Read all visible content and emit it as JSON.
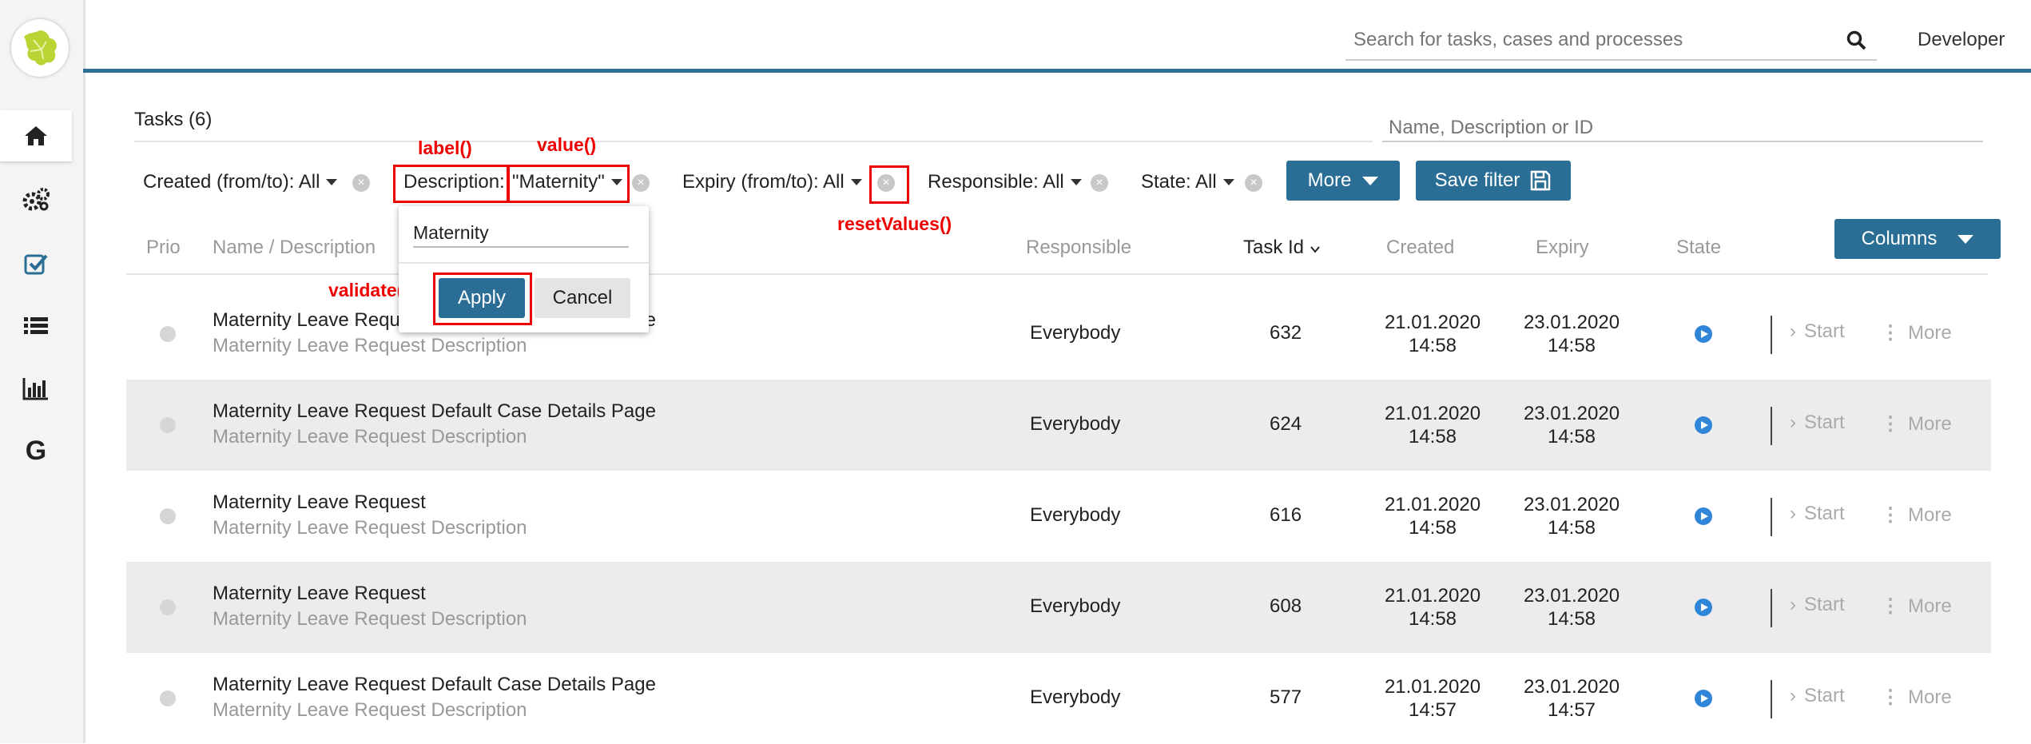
{
  "sidebar": {
    "items": [
      {
        "icon": "home-icon"
      },
      {
        "icon": "gears-icon"
      },
      {
        "icon": "checkbox-icon"
      },
      {
        "icon": "list-icon"
      },
      {
        "icon": "chart-icon"
      },
      {
        "icon": "g-icon",
        "label": "G"
      }
    ]
  },
  "header": {
    "search_placeholder": "Search for tasks, cases and processes",
    "user": "Developer"
  },
  "tasks": {
    "title": "Tasks (6)",
    "quick_search_placeholder": "Name, Description or ID"
  },
  "filters": {
    "created": "Created (from/to): All",
    "description_label": "Description:",
    "description_value": "\"Maternity\"",
    "expiry": "Expiry (from/to): All",
    "responsible": "Responsible: All",
    "state": "State: All",
    "more_button": "More",
    "save_filter_button": "Save filter"
  },
  "popup": {
    "input_value": "Maternity",
    "apply_label": "Apply",
    "cancel_label": "Cancel"
  },
  "annotations": {
    "label": "label()",
    "value": "value()",
    "reset": "resetValues()",
    "validate": "validate()"
  },
  "columns_button": "Columns",
  "table": {
    "headers": {
      "prio": "Prio",
      "name": "Name / Description",
      "responsible": "Responsible",
      "task_id": "Task Id",
      "created": "Created",
      "expiry": "Expiry",
      "state": "State"
    },
    "rows": [
      {
        "name": "Maternity Leave Request Default Case Details Page",
        "description": "Maternity Leave Request Description",
        "responsible": "Everybody",
        "id": "632",
        "created_date": "21.01.2020",
        "created_time": "14:58",
        "expiry_date": "23.01.2020",
        "expiry_time": "14:58"
      },
      {
        "name": "Maternity Leave Request Default Case Details Page",
        "description": "Maternity Leave Request Description",
        "responsible": "Everybody",
        "id": "624",
        "created_date": "21.01.2020",
        "created_time": "14:58",
        "expiry_date": "23.01.2020",
        "expiry_time": "14:58"
      },
      {
        "name": "Maternity Leave Request",
        "description": "Maternity Leave Request Description",
        "responsible": "Everybody",
        "id": "616",
        "created_date": "21.01.2020",
        "created_time": "14:58",
        "expiry_date": "23.01.2020",
        "expiry_time": "14:58"
      },
      {
        "name": "Maternity Leave Request",
        "description": "Maternity Leave Request Description",
        "responsible": "Everybody",
        "id": "608",
        "created_date": "21.01.2020",
        "created_time": "14:58",
        "expiry_date": "23.01.2020",
        "expiry_time": "14:58"
      },
      {
        "name": "Maternity Leave Request Default Case Details Page",
        "description": "Maternity Leave Request Description",
        "responsible": "Everybody",
        "id": "577",
        "created_date": "21.01.2020",
        "created_time": "14:57",
        "expiry_date": "23.01.2020",
        "expiry_time": "14:57"
      }
    ],
    "actions": {
      "start": "Start",
      "more": "More"
    }
  },
  "colors": {
    "primary": "#2b6e95",
    "accent_bar": "#2f6f93",
    "annotation": "#e00000",
    "state_icon": "#2f86d8"
  }
}
